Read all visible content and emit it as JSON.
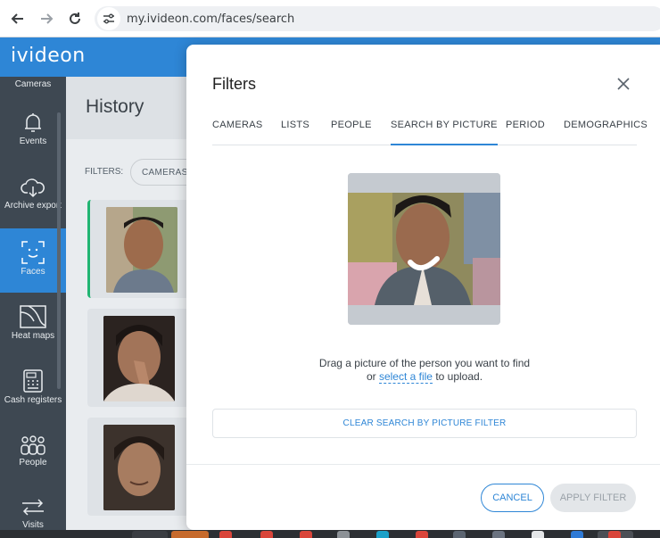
{
  "browser": {
    "url": "my.ivideon.com/faces/search",
    "back_icon": "back-arrow-icon",
    "forward_icon": "forward-arrow-icon",
    "reload_icon": "reload-icon"
  },
  "app": {
    "logo": "ivideon",
    "accent_color": "#2e86d6"
  },
  "sidebar": {
    "items": [
      {
        "label": "Cameras",
        "icon": "camera-icon"
      },
      {
        "label": "Events",
        "icon": "bell-icon"
      },
      {
        "label": "Archive export",
        "icon": "cloud-download-icon"
      },
      {
        "label": "Faces",
        "icon": "face-scan-icon",
        "active": true
      },
      {
        "label": "Heat maps",
        "icon": "heat-map-icon"
      },
      {
        "label": "Cash registers",
        "icon": "cash-register-icon"
      },
      {
        "label": "People",
        "icon": "people-icon"
      },
      {
        "label": "Visits",
        "icon": "visits-arrows-icon"
      }
    ]
  },
  "page": {
    "title": "History",
    "filters_label": "FILTERS:",
    "filter_chip": "CAMERAS"
  },
  "dialog": {
    "title": "Filters",
    "tabs": [
      {
        "label": "CAMERAS"
      },
      {
        "label": "LISTS"
      },
      {
        "label": "PEOPLE"
      },
      {
        "label": "SEARCH BY PICTURE",
        "active": true
      },
      {
        "label": "PERIOD"
      },
      {
        "label": "DEMOGRAPHICS"
      }
    ],
    "drag_text_1": "Drag a picture of the person you want to find",
    "drag_text_or": "or",
    "select_link": "select a file",
    "drag_text_2": "to upload.",
    "clear_button": "CLEAR SEARCH BY PICTURE FILTER",
    "cancel_button": "CANCEL",
    "apply_button": "APPLY FILTER"
  }
}
